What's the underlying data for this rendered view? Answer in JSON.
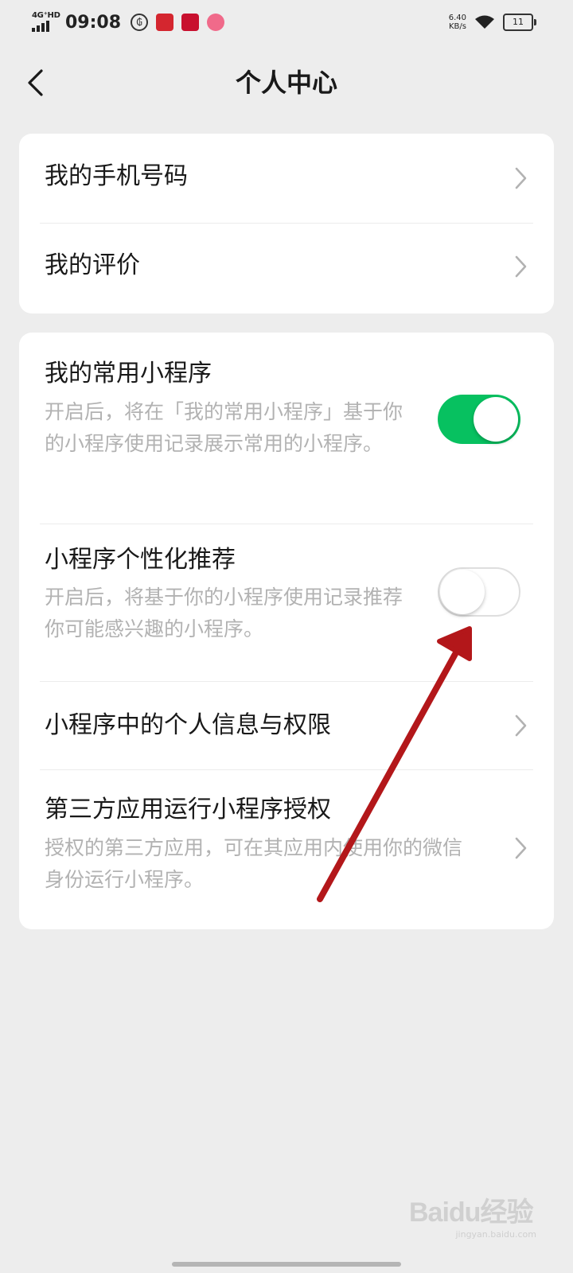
{
  "status_bar": {
    "network": "4G⁺HD",
    "time": "09:08",
    "net_speed_value": "6.40",
    "net_speed_unit": "KB/s",
    "battery": "11"
  },
  "nav": {
    "title": "个人中心"
  },
  "card1": {
    "items": [
      {
        "label": "我的手机号码"
      },
      {
        "label": "我的评价"
      }
    ]
  },
  "card2": {
    "frequent_mini_programs": {
      "title": "我的常用小程序",
      "description": "开启后，将在「我的常用小程序」基于你的小程序使用记录展示常用的小程序。",
      "enabled": true
    },
    "personalized_recommend": {
      "title": "小程序个性化推荐",
      "description": "开启后，将基于你的小程序使用记录推荐你可能感兴趣的小程序。",
      "enabled": false
    },
    "personal_info": {
      "title": "小程序中的个人信息与权限"
    },
    "third_party": {
      "title": "第三方应用运行小程序授权",
      "description": "授权的第三方应用，可在其应用内使用你的微信身份运行小程序。"
    }
  },
  "colors": {
    "background": "#ededed",
    "card": "#ffffff",
    "toggle_on": "#07c160",
    "annotation_arrow": "#b3171a"
  },
  "watermark": {
    "brand": "Baidu经验",
    "url": "jingyan.baidu.com"
  }
}
